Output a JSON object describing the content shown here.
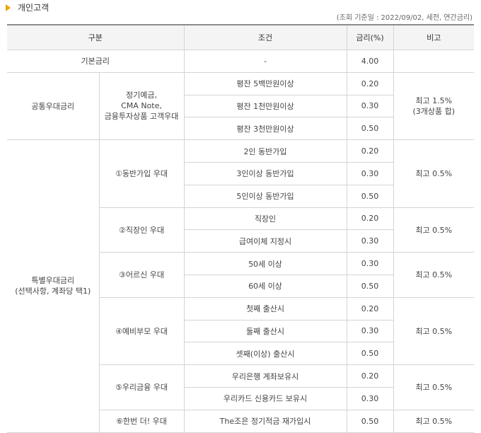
{
  "section": {
    "title": "개인고객",
    "marker_color": "#f0a400"
  },
  "basis_note": "(조회 기준일 : 2022/09/02, 세전, 연간금리)",
  "table": {
    "headers": {
      "category": "구분",
      "condition": "조건",
      "rate": "금리(%)",
      "note": "비고"
    },
    "base": {
      "label": "기본금리",
      "condition": "-",
      "rate": "4.00",
      "note": ""
    },
    "common": {
      "label": "공통우대금리",
      "sub_label": [
        "정기예금,",
        "CMA Note,",
        "금융투자상품 고객우대"
      ],
      "rows": [
        {
          "condition": "평잔 5백만원이상",
          "rate": "0.20"
        },
        {
          "condition": "평잔 1천만원이상",
          "rate": "0.30"
        },
        {
          "condition": "평잔 3천만원이상",
          "rate": "0.50"
        }
      ],
      "note": [
        "최고 1.5%",
        "(3개상품 합)"
      ]
    },
    "special": {
      "label": [
        "특별우대금리",
        "(선택사항, 계좌당 택1)"
      ],
      "groups": [
        {
          "name": "①동반가입 우대",
          "note": "최고 0.5%",
          "rows": [
            {
              "condition": "2인 동반가입",
              "rate": "0.20"
            },
            {
              "condition": "3인이상 동반가입",
              "rate": "0.30"
            },
            {
              "condition": "5인이상 동반가입",
              "rate": "0.50"
            }
          ]
        },
        {
          "name": "②직장인 우대",
          "note": "최고 0.5%",
          "rows": [
            {
              "condition": "직장인",
              "rate": "0.20"
            },
            {
              "condition": "급여이체 지정시",
              "rate": "0.30"
            }
          ]
        },
        {
          "name": "③어르신 우대",
          "note": "최고 0.5%",
          "rows": [
            {
              "condition": "50세 이상",
              "rate": "0.30"
            },
            {
              "condition": "60세 이상",
              "rate": "0.50"
            }
          ]
        },
        {
          "name": "④예비부모 우대",
          "note": "최고 0.5%",
          "rows": [
            {
              "condition": "첫째 출산시",
              "rate": "0.20"
            },
            {
              "condition": "둘째 출산시",
              "rate": "0.30"
            },
            {
              "condition": "셋째(이상) 출산시",
              "rate": "0.50"
            }
          ]
        },
        {
          "name": "⑤우리금융 우대",
          "note": "최고 0.5%",
          "rows": [
            {
              "condition": "우리은행 계좌보유시",
              "rate": "0.20"
            },
            {
              "condition": "우리카드 신용카드 보유시",
              "rate": "0.30"
            }
          ]
        },
        {
          "name": "⑥한번 더! 우대",
          "note": "최고 0.5%",
          "rows": [
            {
              "condition": "The조은 정기적금 재가입시",
              "rate": "0.50"
            }
          ]
        }
      ]
    }
  }
}
